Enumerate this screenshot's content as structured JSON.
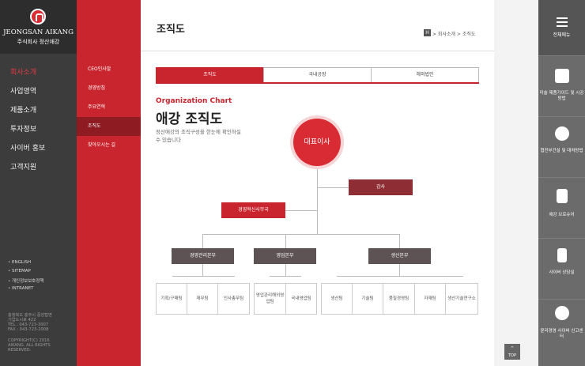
{
  "brand": {
    "name_en": "JEONGSAN AIKANG",
    "name_kr": "주식회사 정산애강"
  },
  "main_menu": [
    {
      "label": "회사소개",
      "active": true
    },
    {
      "label": "사업영역",
      "active": false
    },
    {
      "label": "제품소개",
      "active": false
    },
    {
      "label": "투자정보",
      "active": false
    },
    {
      "label": "사이버 홍보",
      "active": false
    },
    {
      "label": "고객지원",
      "active": false
    }
  ],
  "footer_links": [
    "ENGLISH",
    "SITEMAP",
    "개인정보보호정책",
    "INTRANET"
  ],
  "address_lines": [
    "충청북도 충주시 중앙탑면",
    "기업도시로 422",
    "TEL : 043-723-3007",
    "FAX : 043-723-2008",
    "COPYRIGHT(C) 2016",
    "AIKANG. ALL RIGHTS",
    "RESERVED."
  ],
  "sub_menu": [
    {
      "label": "CEO인사말",
      "active": false
    },
    {
      "label": "경영방침",
      "active": false
    },
    {
      "label": "주요연혁",
      "active": false
    },
    {
      "label": "조직도",
      "active": true
    },
    {
      "label": "찾아오시는 길",
      "active": false
    }
  ],
  "page": {
    "title": "조직도",
    "breadcrumb_home": "H",
    "breadcrumb": "> 회사소개 > 조직도",
    "tabs": [
      {
        "label": "조직도",
        "active": true
      },
      {
        "label": "국내공장",
        "active": false
      },
      {
        "label": "해외법인",
        "active": false
      }
    ],
    "org_title_en": "Organization Chart",
    "org_title_kr": "애강 조직도",
    "org_desc": "정산애강의 조직구성을 한눈에 확인하실 수 있습니다"
  },
  "org_chart": {
    "ceo": "대표이사",
    "auditor": "감사",
    "innovation": "경영혁신사무국",
    "divisions": [
      "경영관리본부",
      "영업본부",
      "생산본부"
    ],
    "teams": [
      [
        "기획/구매팀",
        "재무팀",
        "인사총무팀"
      ],
      [
        "영업관리해외영업팀",
        "국내영업팀"
      ],
      [
        "생산팀",
        "기술팀",
        "품질경영팀",
        "자재팀",
        "생산기술연구소"
      ]
    ]
  },
  "right_menu": {
    "all_menu": "전체메뉴",
    "items": [
      {
        "label": "미술 제품가이드 및 시공방법",
        "icon": "monitor-icon"
      },
      {
        "label": "협진부건설 및 대처방법",
        "icon": "search-icon"
      },
      {
        "label": "애강 브로슈어",
        "icon": "brochure-icon"
      },
      {
        "label": "사이버 상담실",
        "icon": "door-icon"
      },
      {
        "label": "윤리경영 사이버 신고센터",
        "icon": "report-icon"
      }
    ]
  },
  "top_button": "TOP"
}
